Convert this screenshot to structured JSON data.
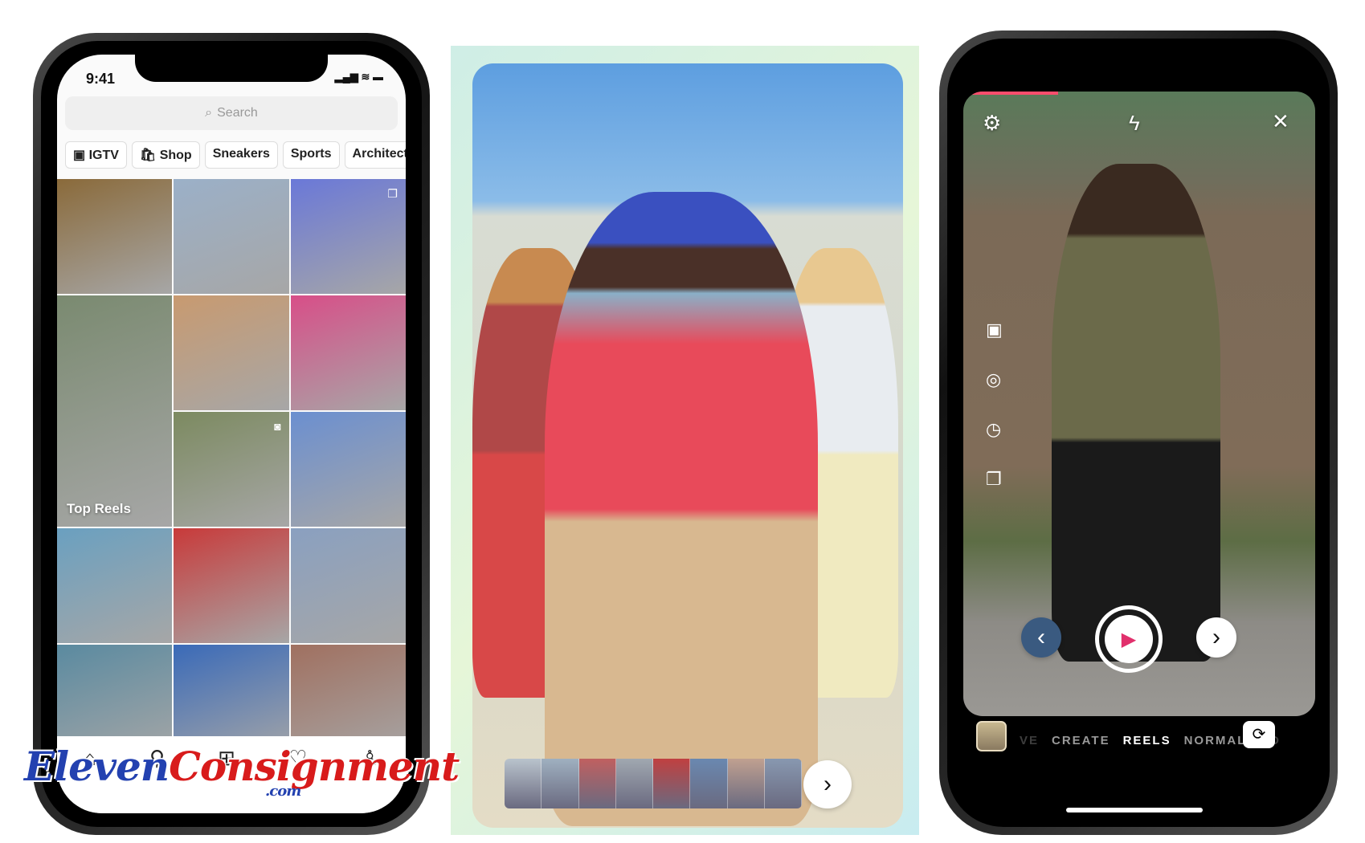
{
  "explore": {
    "time": "9:41",
    "status_icons": "▂▄▆ ≋ ▬",
    "search_placeholder": "Search",
    "chips": [
      {
        "label": "IGTV",
        "icon": "igtv-icon"
      },
      {
        "label": "Shop",
        "icon": "shop-bag-icon"
      },
      {
        "label": "Sneakers"
      },
      {
        "label": "Sports"
      },
      {
        "label": "Architect"
      }
    ],
    "top_reels_label": "Top Reels",
    "grid_colors": [
      "#8a6a3a",
      "#9bb0c8",
      "#6a78d8",
      "#7a8a70",
      "#c89a70",
      "#d84e88",
      "#7c8a60",
      "#6b8fd0",
      "#6aa0c0",
      "#c83a3a",
      "#8aa0c0",
      "#5a8aa0",
      "#3a6ab8",
      "#a07060",
      "#6a7a50"
    ],
    "nav_icons": [
      "home-icon",
      "search-icon",
      "create-icon",
      "heart-icon",
      "profile-icon"
    ]
  },
  "watermark": {
    "part1": "Eleven",
    "part2": "Consignment",
    "suffix": ".com"
  },
  "editor": {
    "next_icon": "›",
    "film_colors": [
      "#b9c3cc",
      "#9fb0c0",
      "#c06060",
      "#a0a8b0",
      "#c04040",
      "#6a88b0",
      "#c0a090",
      "#8898b0"
    ]
  },
  "camera": {
    "modes": [
      "VE",
      "CREATE",
      "REELS",
      "NORMAL",
      "BO"
    ],
    "active_mode": "REELS",
    "accent": "#ff4d6d",
    "next_icon": "›",
    "back_icon": "‹"
  }
}
